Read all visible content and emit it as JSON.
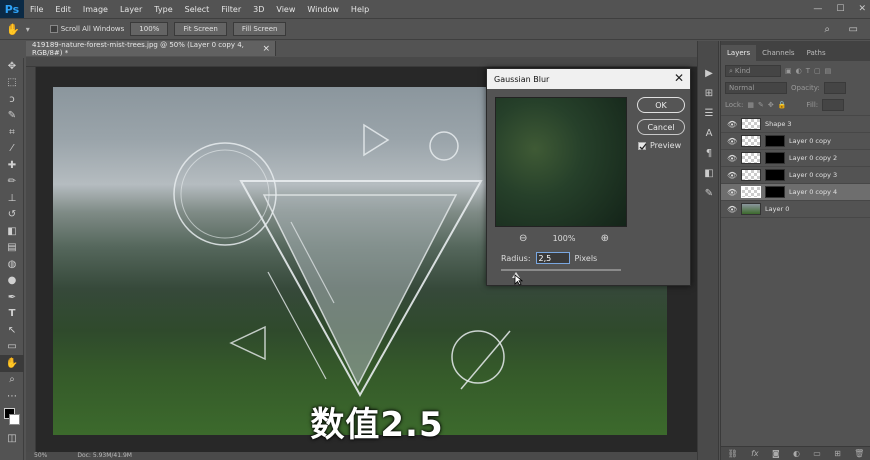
{
  "app": {
    "logo": "Ps"
  },
  "menu": [
    "File",
    "Edit",
    "Image",
    "Layer",
    "Type",
    "Select",
    "Filter",
    "3D",
    "View",
    "Window",
    "Help"
  ],
  "window_controls": {
    "minimize": "—",
    "maximize": "☐",
    "close": "✕"
  },
  "options_bar": {
    "scroll_all_windows": "Scroll All Windows",
    "zoom_value": "100%",
    "fit_screen": "Fit Screen",
    "fill_screen": "Fill Screen"
  },
  "document": {
    "tab_title": "419189-nature-forest-mist-trees.jpg @ 50% (Layer 0 copy 4, RGB/8#) *",
    "close_label": "×",
    "status_zoom": "50%",
    "status_doc": "Doc: 5.93M/41.9M"
  },
  "overlay_caption": "数值2.5",
  "dialog": {
    "title": "Gaussian Blur",
    "close": "✕",
    "ok": "OK",
    "cancel": "Cancel",
    "preview_label": "Preview",
    "preview_checked": true,
    "zoom_out": "⊖",
    "zoom_level": "100%",
    "zoom_in": "⊕",
    "radius_label": "Radius:",
    "radius_value": "2,5",
    "radius_unit": "Pixels",
    "slider_level_fraction": 0.1
  },
  "layers_panel": {
    "tabs": [
      "Layers",
      "Channels",
      "Paths"
    ],
    "kind_label": "Kind",
    "blend_mode": "Normal",
    "opacity_label": "Opacity:",
    "lock_label": "Lock:",
    "fill_label": "Fill:",
    "layers": [
      {
        "name": "Shape 3",
        "thumb": "checker",
        "mask": false,
        "selected": false
      },
      {
        "name": "Layer 0 copy",
        "thumb": "checker",
        "mask": true,
        "selected": false
      },
      {
        "name": "Layer 0 copy 2",
        "thumb": "checker",
        "mask": true,
        "selected": false
      },
      {
        "name": "Layer 0 copy 3",
        "thumb": "checker",
        "mask": true,
        "selected": false
      },
      {
        "name": "Layer 0 copy 4",
        "thumb": "checker",
        "mask": true,
        "selected": true
      },
      {
        "name": "Layer 0",
        "thumb": "photo",
        "mask": false,
        "selected": false
      }
    ],
    "footer_icons": [
      "link-icon",
      "fx-icon",
      "mask-icon",
      "adjustment-icon",
      "folder-icon",
      "new-layer-icon",
      "trash-icon"
    ]
  }
}
